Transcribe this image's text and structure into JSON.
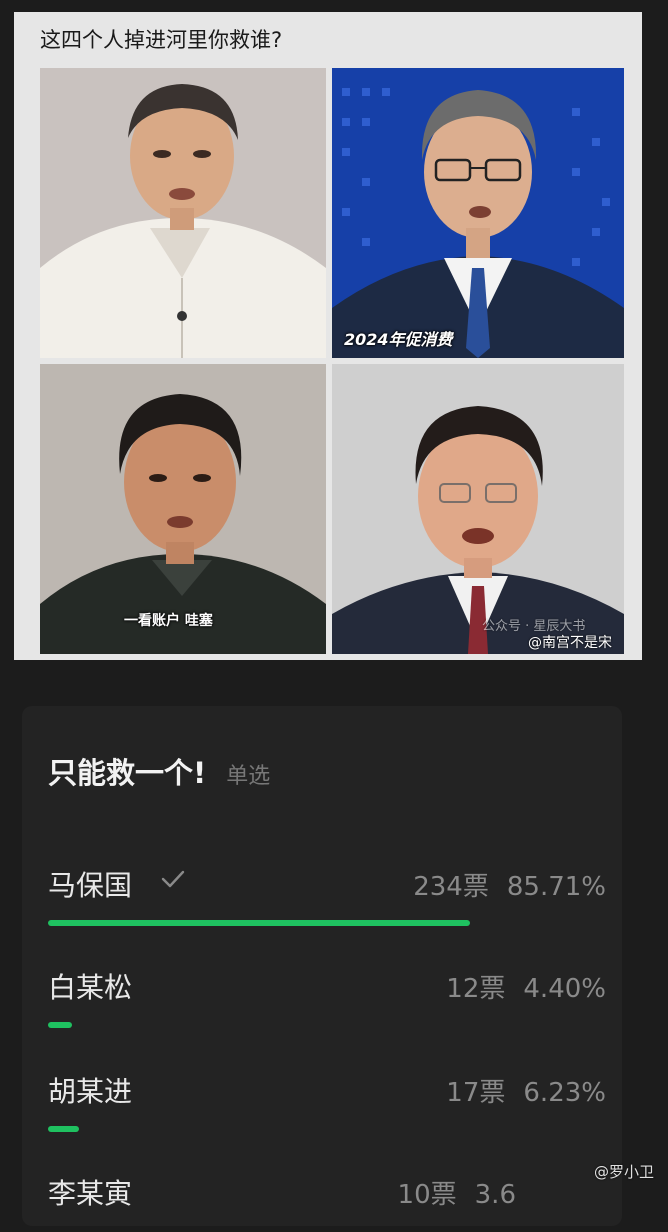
{
  "post": {
    "question": "这四个人掉进河里你救谁?",
    "captions": {
      "top_right": "2024年促消费",
      "bottom_left": "一看账户 哇塞"
    },
    "watermark": "@南宫不是宋",
    "watermark_faded": "公众号 · 星辰大书"
  },
  "poll": {
    "title": "只能救一个!",
    "type": "单选",
    "accent_color": "#1fc160",
    "options": [
      {
        "name": "马保国",
        "votes": "234票",
        "percent": "85.71%",
        "selected": true,
        "fraction": 0.8571
      },
      {
        "name": "白某松",
        "votes": "12票",
        "percent": "4.40%",
        "selected": false,
        "fraction": 0.044
      },
      {
        "name": "胡某进",
        "votes": "17票",
        "percent": "6.23%",
        "selected": false,
        "fraction": 0.0623
      },
      {
        "name": "李某寅",
        "votes": "10票",
        "percent": "3.6",
        "selected": false,
        "fraction": 0.036
      }
    ]
  },
  "footer": {
    "watermark": "@罗小卫"
  }
}
